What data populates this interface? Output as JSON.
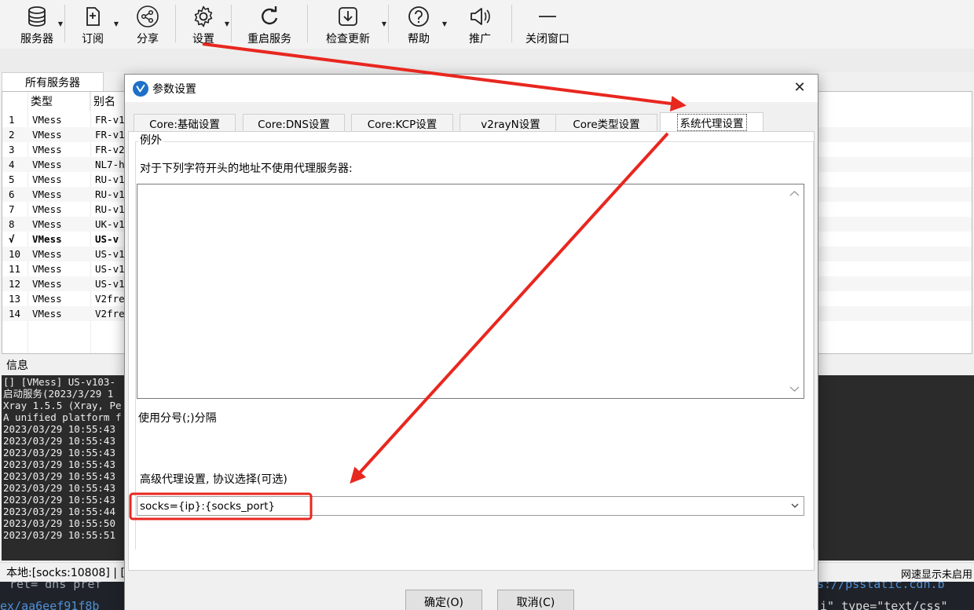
{
  "toolbar": {
    "items": [
      {
        "label": "服务器",
        "icon": "database-icon",
        "dropdown": true
      },
      {
        "label": "订阅",
        "icon": "subscribe-icon",
        "dropdown": true
      },
      {
        "label": "分享",
        "icon": "share-icon",
        "dropdown": false
      },
      {
        "label": "设置",
        "icon": "gear-icon",
        "dropdown": true
      },
      {
        "label": "重启服务",
        "icon": "restart-icon",
        "dropdown": false
      },
      {
        "label": "检查更新",
        "icon": "download-icon",
        "dropdown": true
      },
      {
        "label": "帮助",
        "icon": "help-icon",
        "dropdown": true
      },
      {
        "label": "推广",
        "icon": "speaker-icon",
        "dropdown": false
      },
      {
        "label": "关闭窗口",
        "icon": "minimize-icon",
        "dropdown": false
      }
    ]
  },
  "server_tab": "所有服务器",
  "server_list": {
    "headers": [
      "类型",
      "别名"
    ],
    "rows": [
      {
        "num": "1",
        "type": "VMess",
        "alias": "FR-v1",
        "active": false
      },
      {
        "num": "2",
        "type": "VMess",
        "alias": "FR-v1",
        "active": false
      },
      {
        "num": "3",
        "type": "VMess",
        "alias": "FR-v2",
        "active": false
      },
      {
        "num": "4",
        "type": "VMess",
        "alias": "NL7-h",
        "active": false
      },
      {
        "num": "5",
        "type": "VMess",
        "alias": "RU-v1",
        "active": false
      },
      {
        "num": "6",
        "type": "VMess",
        "alias": "RU-v1",
        "active": false
      },
      {
        "num": "7",
        "type": "VMess",
        "alias": "RU-v1",
        "active": false
      },
      {
        "num": "8",
        "type": "VMess",
        "alias": "UK-v1",
        "active": false
      },
      {
        "num": "√",
        "type": "VMess",
        "alias": "US-v",
        "active": true
      },
      {
        "num": "10",
        "type": "VMess",
        "alias": "US-v1",
        "active": false
      },
      {
        "num": "11",
        "type": "VMess",
        "alias": "US-v1",
        "active": false
      },
      {
        "num": "12",
        "type": "VMess",
        "alias": "US-v1",
        "active": false
      },
      {
        "num": "13",
        "type": "VMess",
        "alias": "V2fre",
        "active": false
      },
      {
        "num": "14",
        "type": "VMess",
        "alias": "V2fre",
        "active": false
      }
    ]
  },
  "info_label": "信息",
  "log_lines": [
    "[] [VMess] US-v103-",
    "启动服务(2023/3/29 1",
    "Xray 1.5.5 (Xray, Pe",
    "A unified platform f",
    "2023/03/29 10:55:43",
    "2023/03/29 10:55:43",
    "2023/03/29 10:55:43",
    "2023/03/29 10:55:43",
    "2023/03/29 10:55:43",
    "2023/03/29 10:55:43",
    "2023/03/29 10:55:43",
    "2023/03/29 10:55:44",
    "2023/03/29 10:55:50",
    "2023/03/29 10:55:51"
  ],
  "status": {
    "left": "本地:[socks:10808] | [",
    "right": "网速显示未启用"
  },
  "background_code": {
    "line1": "ret= dns pref",
    "line1_right": "s://psstatic.cdn.b",
    "line2": "ex/aa6eef91f8b",
    "line2_right": "i\" type=\"text/css\""
  },
  "dialog": {
    "title": "参数设置",
    "close": "✕",
    "tabs": [
      "Core:基础设置",
      "Core:DNS设置",
      "Core:KCP设置",
      "v2rayN设置",
      "Core类型设置",
      "系统代理设置"
    ],
    "selected_tab": "系统代理设置",
    "group_title": "例外",
    "exceptions_desc": "对于下列字符开头的地址不使用代理服务器:",
    "exceptions_value": "",
    "separator_hint": "使用分号(;)分隔",
    "advanced_label": "高级代理设置, 协议选择(可选)",
    "advanced_value": "socks={ip}:{socks_port}",
    "ok": "确定(O)",
    "cancel": "取消(C)"
  },
  "colors": {
    "annotation": "#e8271f",
    "log_bg": "#2b2b2b",
    "logo": "#1e6fc8"
  }
}
